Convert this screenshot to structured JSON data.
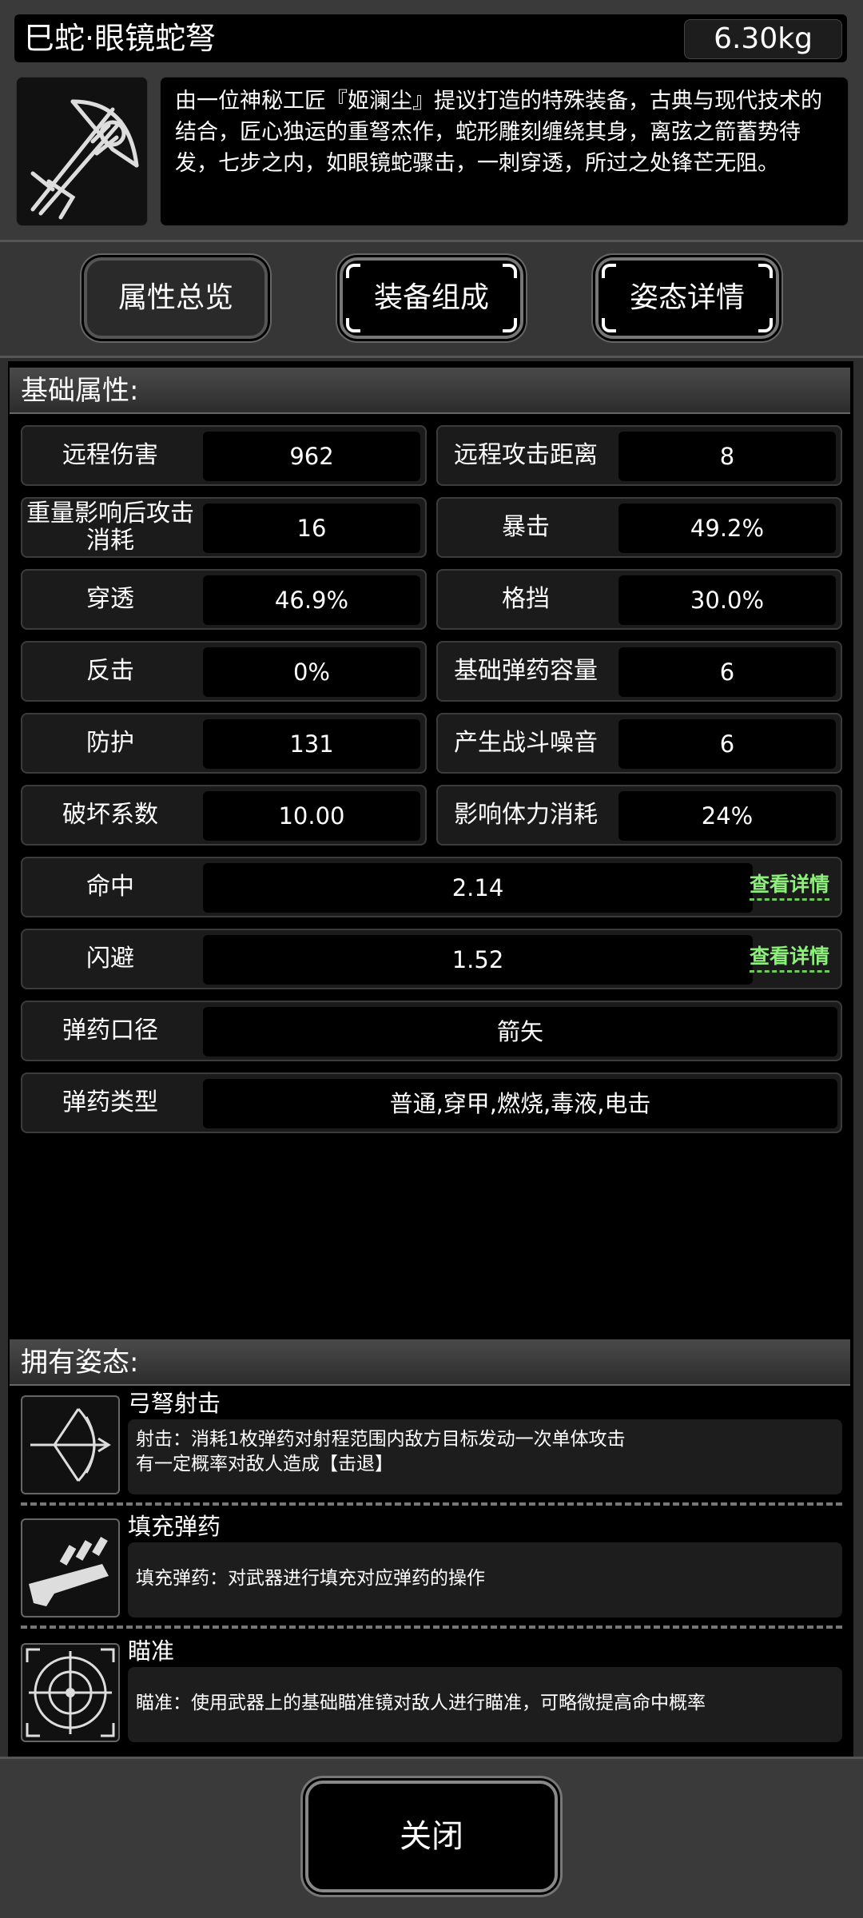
{
  "header": {
    "title": "巳蛇·眼镜蛇弩",
    "weight": "6.30kg",
    "description": "由一位神秘工匠『姬澜尘』提议打造的特殊装备，古典与现代技术的结合，匠心独运的重弩杰作，蛇形雕刻缠绕其身，离弦之箭蓄势待发，七步之内，如眼镜蛇骤击，一刺穿透，所过之处锋芒无阻。"
  },
  "tabs": [
    {
      "label": "属性总览",
      "active": true
    },
    {
      "label": "装备组成",
      "active": false
    },
    {
      "label": "姿态详情",
      "active": false
    }
  ],
  "base_section": {
    "title": "基础属性:",
    "pairs": [
      {
        "l_label": "远程伤害",
        "l_value": "962",
        "r_label": "远程攻击距离",
        "r_value": "8"
      },
      {
        "l_label": "重量影响后攻击消耗",
        "l_value": "16",
        "r_label": "暴击",
        "r_value": "49.2%"
      },
      {
        "l_label": "穿透",
        "l_value": "46.9%",
        "r_label": "格挡",
        "r_value": "30.0%"
      },
      {
        "l_label": "反击",
        "l_value": "0%",
        "r_label": "基础弹药容量",
        "r_value": "6"
      },
      {
        "l_label": "防护",
        "l_value": "131",
        "r_label": "产生战斗噪音",
        "r_value": "6"
      },
      {
        "l_label": "破坏系数",
        "l_value": "10.00",
        "r_label": "影响体力消耗",
        "r_value": "24%"
      }
    ],
    "wide": [
      {
        "label": "命中",
        "value": "2.14",
        "link": "查看详情"
      },
      {
        "label": "闪避",
        "value": "1.52",
        "link": "查看详情"
      },
      {
        "label": "弹药口径",
        "value": "箭矢"
      },
      {
        "label": "弹药类型",
        "value": "普通,穿甲,燃烧,毒液,电击"
      }
    ]
  },
  "stance_section": {
    "title": "拥有姿态:",
    "items": [
      {
        "name": "弓弩射击",
        "icon": "crossbow-shot-icon",
        "desc1": "射击：消耗1枚弹药对射程范围内敌方目标发动一次单体攻击",
        "desc2": "有一定概率对敌人造成【击退】"
      },
      {
        "name": "填充弹药",
        "icon": "reload-ammo-icon",
        "desc1": "填充弹药：对武器进行填充对应弹药的操作",
        "desc2": ""
      },
      {
        "name": "瞄准",
        "icon": "crosshair-icon",
        "desc1": "瞄准：使用武器上的基础瞄准镜对敌人进行瞄准，可略微提高命中概率",
        "desc2": ""
      }
    ]
  },
  "footer": {
    "close_label": "关闭"
  }
}
